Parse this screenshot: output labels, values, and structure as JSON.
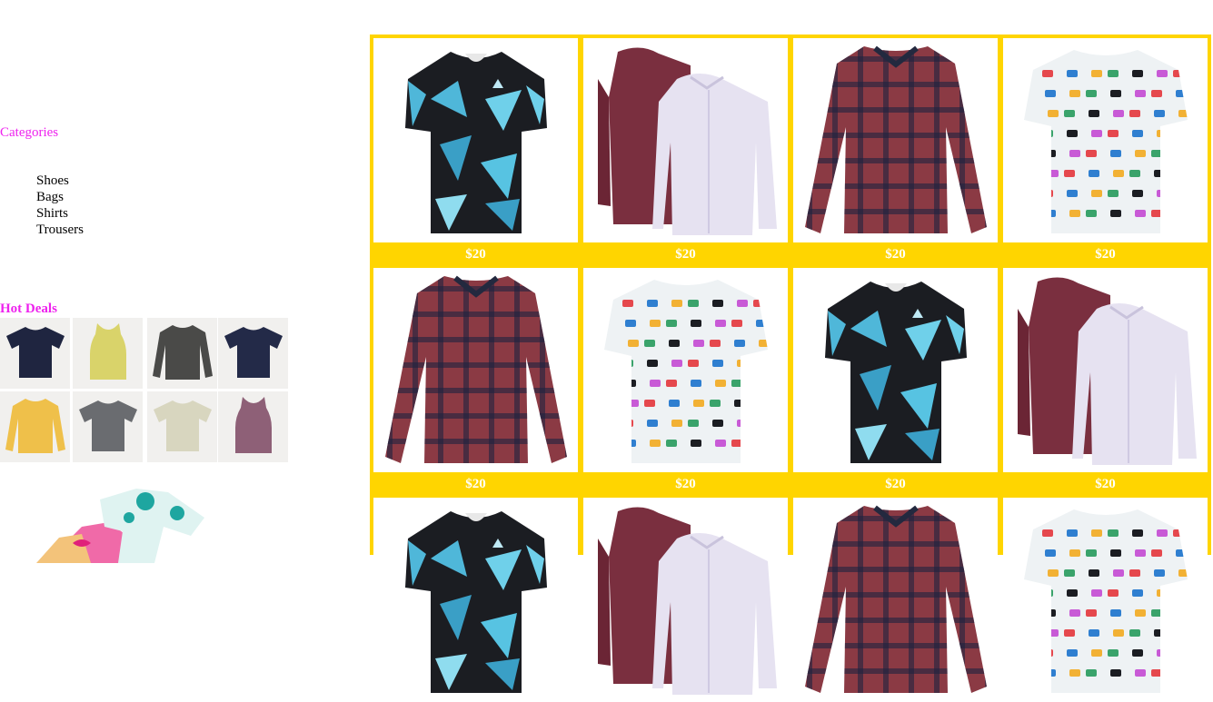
{
  "sidebar": {
    "categories_label": "Categories",
    "categories": [
      "Shoes",
      "Bags",
      "Shirts",
      "Trousers"
    ],
    "hot_deals_label": "Hot Deals",
    "hot_deals": [
      {
        "icon": "tshirt-navy-icon",
        "color": "#1f2540"
      },
      {
        "icon": "tank-top-yellow-icon",
        "color": "#d9d36a"
      },
      {
        "icon": "longsleeve-charcoal-icon",
        "color": "#4a4a48"
      },
      {
        "icon": "tshirt-navy-icon",
        "color": "#232a48"
      },
      {
        "icon": "longsleeve-yellow-icon",
        "color": "#efc04a"
      },
      {
        "icon": "tshirt-grey-icon",
        "color": "#6a6c70"
      },
      {
        "icon": "tshirt-cream-icon",
        "color": "#d8d6bf"
      },
      {
        "icon": "tank-top-mauve-icon",
        "color": "#8e6077"
      }
    ]
  },
  "products": [
    {
      "price": "$20",
      "style": "blue-geo"
    },
    {
      "price": "$20",
      "style": "burgundy-white"
    },
    {
      "price": "$20",
      "style": "plaid"
    },
    {
      "price": "$20",
      "style": "hawaiian"
    },
    {
      "price": "$20",
      "style": "plaid"
    },
    {
      "price": "$20",
      "style": "hawaiian"
    },
    {
      "price": "$20",
      "style": "blue-geo"
    },
    {
      "price": "$20",
      "style": "burgundy-white"
    },
    {
      "price": "",
      "style": "blue-geo"
    },
    {
      "price": "",
      "style": "burgundy-white"
    },
    {
      "price": "",
      "style": "plaid"
    },
    {
      "price": "",
      "style": "hawaiian"
    }
  ],
  "colors": {
    "accent": "#ffd500",
    "link": "#ee22ee"
  }
}
